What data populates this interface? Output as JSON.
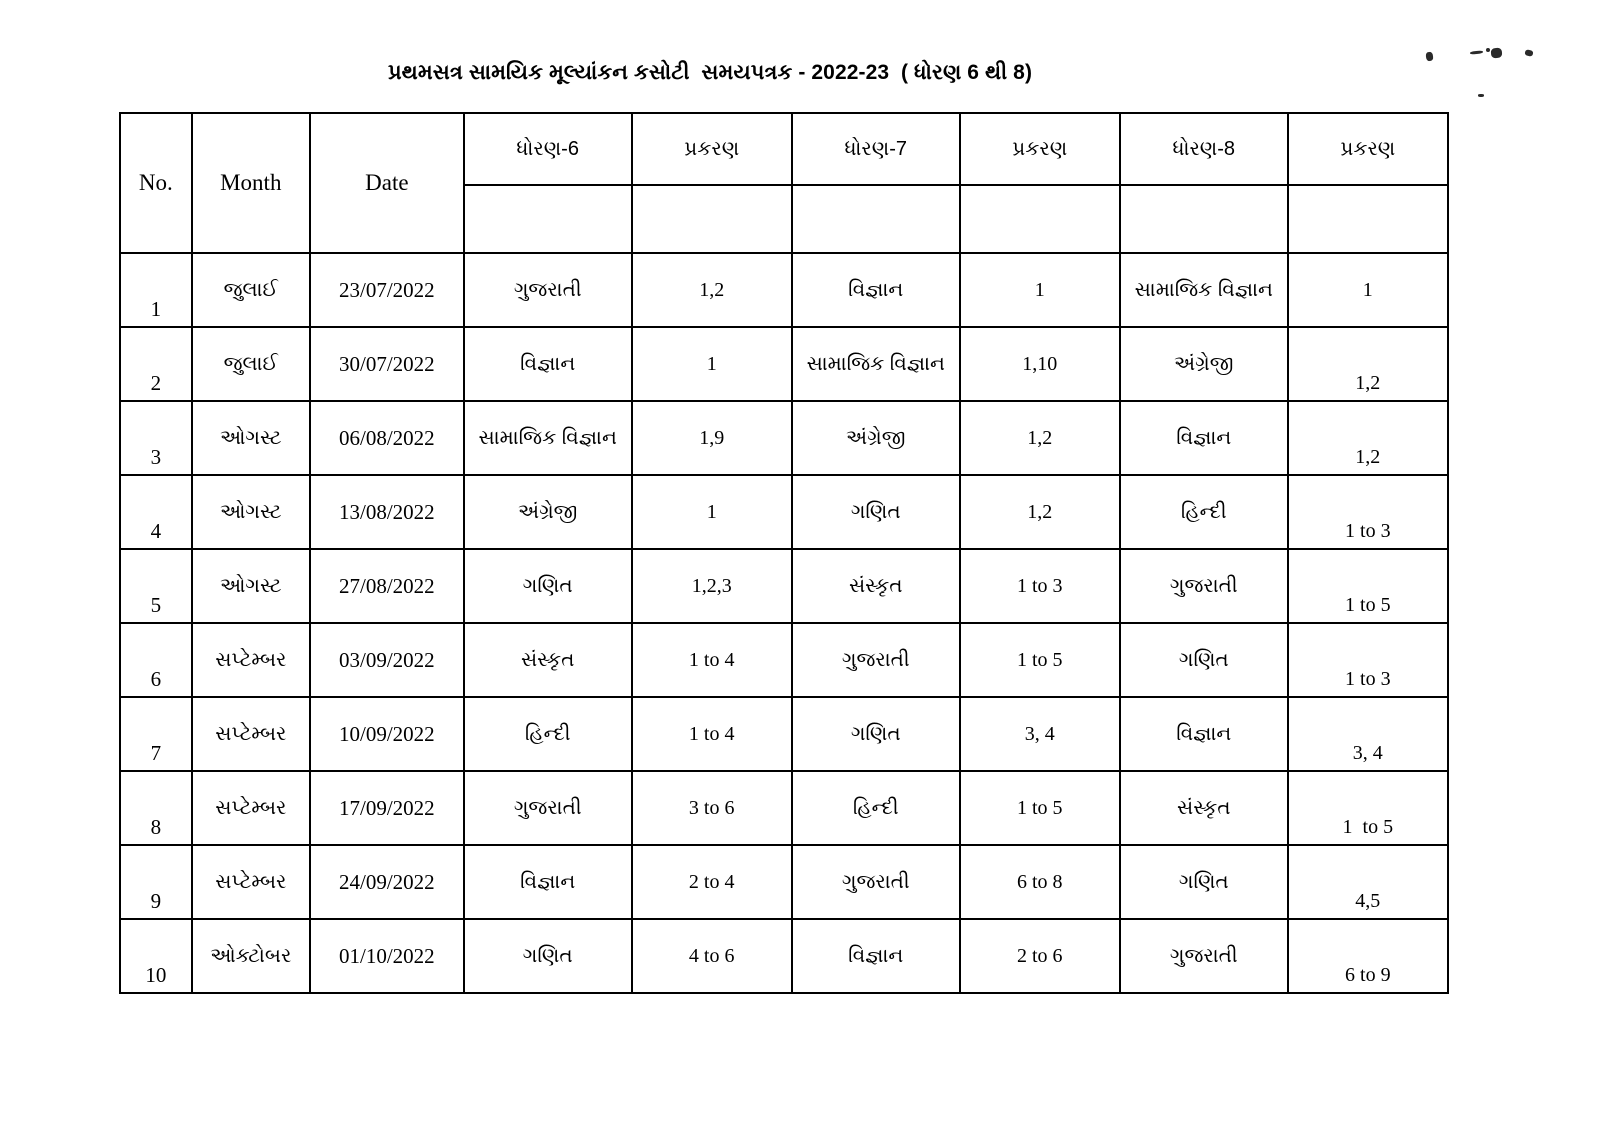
{
  "document": {
    "title": "પ્રથમસત્ર સામયિક મૂલ્યાંકન કસોટી  સમયપત્રક - 2022-23  ( ધોરણ 6 થી 8)"
  },
  "table": {
    "headers": {
      "no": "No.",
      "month": "Month",
      "date": "Date",
      "std6": "ધોરણ-6",
      "chapter6": "પ્રકરણ",
      "std7": "ધોરણ-7",
      "chapter7": "પ્રકરણ",
      "std8": "ધોરણ-8",
      "chapter8": "પ્રકરણ"
    },
    "rows": [
      {
        "no": "1",
        "month": "જુલાઈ",
        "date": "23/07/2022",
        "subject6": "ગુજરાતી",
        "chapter6": "1,2",
        "subject7": "વિજ્ઞાન",
        "chapter7": "1",
        "subject8": "સામાજિક વિજ્ઞાન",
        "chapter8": "1"
      },
      {
        "no": "2",
        "month": "જુલાઈ",
        "date": "30/07/2022",
        "subject6": "વિજ્ઞાન",
        "chapter6": "1",
        "subject7": "સામાજિક વિજ્ઞાન",
        "chapter7": "1,10",
        "subject8": "અંગ્રેજી",
        "chapter8": "1,2"
      },
      {
        "no": "3",
        "month": "ઓગસ્ટ",
        "date": "06/08/2022",
        "subject6": "સામાજિક વિજ્ઞાન",
        "chapter6": "1,9",
        "subject7": "અંગ્રેજી",
        "chapter7": "1,2",
        "subject8": "વિજ્ઞાન",
        "chapter8": "1,2"
      },
      {
        "no": "4",
        "month": "ઓગસ્ટ",
        "date": "13/08/2022",
        "subject6": "અંગ્રેજી",
        "chapter6": "1",
        "subject7": "ગણિત",
        "chapter7": "1,2",
        "subject8": "હિન્દી",
        "chapter8": "1 to 3"
      },
      {
        "no": "5",
        "month": "ઓગસ્ટ",
        "date": "27/08/2022",
        "subject6": "ગણિત",
        "chapter6": "1,2,3",
        "subject7": "સંસ્કૃત",
        "chapter7": "1 to 3",
        "subject8": "ગુજરાતી",
        "chapter8": "1 to 5"
      },
      {
        "no": "6",
        "month": "સપ્ટેમ્બર",
        "date": "03/09/2022",
        "subject6": "સંસ્કૃત",
        "chapter6": "1 to 4",
        "subject7": "ગુજરાતી",
        "chapter7": "1 to 5",
        "subject8": "ગણિત",
        "chapter8": "1 to 3"
      },
      {
        "no": "7",
        "month": "સપ્ટેમ્બર",
        "date": "10/09/2022",
        "subject6": "હિન્દી",
        "chapter6": "1 to 4",
        "subject7": "ગણિત",
        "chapter7": "3, 4",
        "subject8": "વિજ્ઞાન",
        "chapter8": "3, 4"
      },
      {
        "no": "8",
        "month": "સપ્ટેમ્બર",
        "date": "17/09/2022",
        "subject6": "ગુજરાતી",
        "chapter6": "3 to 6",
        "subject7": "હિન્દી",
        "chapter7": "1 to 5",
        "subject8": "સંસ્કૃત",
        "chapter8": "1  to 5"
      },
      {
        "no": "9",
        "month": "સપ્ટેમ્બર",
        "date": "24/09/2022",
        "subject6": "વિજ્ઞાન",
        "chapter6": "2 to 4",
        "subject7": "ગુજરાતી",
        "chapter7": "6 to 8",
        "subject8": "ગણિત",
        "chapter8": "4,5"
      },
      {
        "no": "10",
        "month": "ઓક્ટોબર",
        "date": "01/10/2022",
        "subject6": "ગણિત",
        "chapter6": "4 to 6",
        "subject7": "વિજ્ઞાન",
        "chapter7": "2 to 6",
        "subject8": "ગુજરાતી",
        "chapter8": "6 to 9"
      }
    ]
  }
}
